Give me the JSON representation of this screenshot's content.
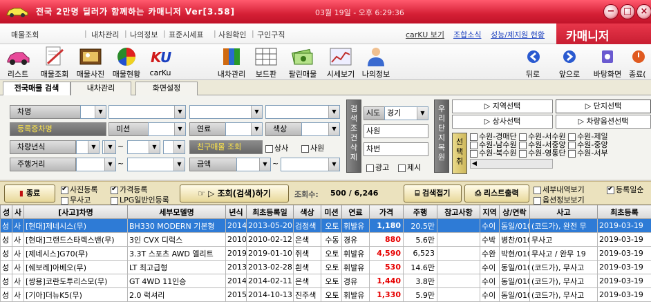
{
  "window": {
    "title": "전국 2만명 딜러가 함께하는 카매니저 Ver[3.58]",
    "clock": "03월 19일 - 오후 6:29:36",
    "brand": "카매니저"
  },
  "menu": {
    "items": [
      "매물조회",
      "내차관리",
      "나의정보",
      "표준시세표",
      "사원확인",
      "구인구직"
    ],
    "links": [
      "carKU 보기",
      "조합소식",
      "성능/제지원 현황"
    ],
    "link_colors": [
      "#333333",
      "#1a3fbf",
      "#1a3fbf"
    ]
  },
  "toolbar": {
    "left": [
      "리스트",
      "매물조회",
      "매물사진",
      "매물현황",
      "carKu"
    ],
    "middle": [
      "내차관리",
      "보드판",
      "팔린매물",
      "시세보기",
      "나의정보"
    ],
    "right": [
      "뒤로",
      "앞으로",
      "바탕화면",
      "종료("
    ]
  },
  "tabs": [
    "전국매물 검색",
    "내차관리",
    "화면설정"
  ],
  "search": {
    "labels": {
      "car_name": "차명",
      "reg_date": "등록증차명",
      "mission": "미션",
      "fuel": "연료",
      "color": "색상",
      "year": "차량년식",
      "friend_car": "친구매물 조회",
      "mileage": "주행거리",
      "price": "금액"
    },
    "options": {
      "dealer": "상사",
      "staff": "사원",
      "ad": "광고",
      "offer": "제시"
    },
    "vertical": {
      "reset": "검색조건삭제",
      "restore": "우리단지복원",
      "select": "선택취"
    },
    "fields": {
      "city": "시도",
      "city_value": "경기",
      "employee": "사원",
      "car": "차번"
    },
    "region_buttons": [
      "▷ 지역선택",
      "▷ 단지선택",
      "▷ 상사선택",
      "▷ 차량옵션선택"
    ],
    "regions": [
      [
        "수원-경매단",
        "수원-서수원",
        "수원-제일"
      ],
      [
        "수원-남수원",
        "수원-서중앙",
        "수원-중앙"
      ],
      [
        "수원-북수원",
        "수원-영통단",
        "수원-서부"
      ]
    ]
  },
  "actions": {
    "close": "종료",
    "photo_reg": "사진등록",
    "price_reg": "가격등록",
    "no_accident": "무사고",
    "lpg": "LPG일반인등록",
    "query": "▷ 조회(검색)하기",
    "count_label": "조회수:",
    "count": "500 / 6,246",
    "collapse": "검색접기",
    "print": "리스트출력",
    "detail_view": "세부내역보기",
    "option_view": "옵션정보보기",
    "reg_date_sort": "등록일순"
  },
  "grid": {
    "headers": [
      "성",
      "사",
      "[사고]차명",
      "세부모델명",
      "년식",
      "최초등록일",
      "색상",
      "미션",
      "연료",
      "가격",
      "주행",
      "참고사항",
      "지역",
      "상/연락",
      "사고",
      "최초등록"
    ],
    "rows": [
      [
        "성",
        "사",
        "[현대]제네시스(무)",
        "BH330 MODERN 기본형",
        "2014",
        "2013-05-20",
        "검정색",
        "오토",
        "휘발유",
        "1,180",
        "20.5만",
        "",
        "수이",
        "동일/010-",
        "(코드가), 완전 무",
        "2019-03-19"
      ],
      [
        "성",
        "사",
        "[현대]그랜드스타렉스밴(무)",
        "3인 CVX 디럭스",
        "2010",
        "2010-02-12",
        "은색",
        "수동",
        "경유",
        "880",
        "5.6만",
        "",
        "수박",
        "병찬/010-",
        "무사고",
        "2019-03-19"
      ],
      [
        "성",
        "사",
        "[제네시스]G70(무)",
        "3.3T 스포츠 AWD 엘리트",
        "2019",
        "2019-01-10",
        "쥐색",
        "오토",
        "휘발유",
        "4,590",
        "6,523",
        "",
        "수완",
        "박현/010-",
        "무사고 / 완무 19",
        "2019-03-19"
      ],
      [
        "성",
        "사",
        "[쉐보레]아베오(무)",
        "LT 최고급형",
        "2013",
        "2013-02-28",
        "흰색",
        "오토",
        "휘발유",
        "530",
        "14.6만",
        "",
        "수이",
        "동일/010-",
        "(코드가), 무사고",
        "2019-03-19"
      ],
      [
        "성",
        "사",
        "[쌍용]코란도투리스모(무)",
        "GT 4WD 11인승",
        "2014",
        "2014-02-11",
        "은색",
        "오토",
        "경유",
        "1,440",
        "3.8만",
        "",
        "수이",
        "동일/010-",
        "(코드가), 무사고",
        "2019-03-19"
      ],
      [
        "성",
        "사",
        "[기아]더뉴K5(무)",
        "2.0 럭셔리",
        "2015",
        "2014-10-13",
        "진주색",
        "오토",
        "휘발유",
        "1,330",
        "5.9만",
        "",
        "수이",
        "동일/010-",
        "(코드가), 무사고",
        "2019-03-19"
      ]
    ]
  }
}
